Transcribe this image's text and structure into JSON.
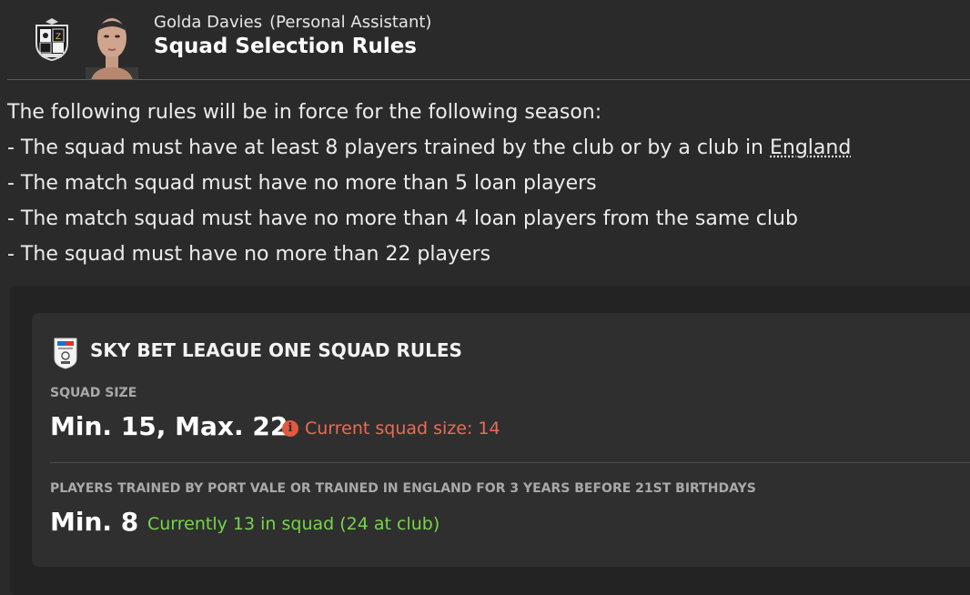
{
  "header": {
    "sender_name": "Golda Davies",
    "sender_role": "(Personal Assistant)",
    "subject": "Squad Selection Rules",
    "club_badge_icon": "port-vale-crest-icon",
    "avatar_icon": "assistant-portrait"
  },
  "message": {
    "intro": "The following rules will be in force for the following season:",
    "rules": [
      {
        "prefix": "- The squad must have at least 8 players trained by the club or by a club in ",
        "link": "England"
      },
      {
        "text": "- The match squad must have no more than 5 loan players"
      },
      {
        "text": "- The match squad must have no more than 4 loan players from the same club"
      },
      {
        "text": "- The squad must have no more than 22 players"
      }
    ]
  },
  "rules_card": {
    "league_badge_icon": "sky-bet-league-one-badge-icon",
    "title": "SKY BET LEAGUE ONE SQUAD RULES",
    "squad_size": {
      "label": "SQUAD SIZE",
      "value": "Min. 15, Max. 22",
      "status": "Current squad size: 14",
      "status_color": "#ef6a55"
    },
    "trained_players": {
      "label": "PLAYERS TRAINED BY PORT VALE OR TRAINED IN ENGLAND FOR 3 YEARS BEFORE 21ST BIRTHDAYS",
      "value": "Min. 8",
      "status": "Currently 13 in squad (24 at club)",
      "status_color": "#77d64a"
    }
  },
  "colors": {
    "background": "#2a2a2a",
    "card": "#2f2f2f",
    "panel": "#232323"
  }
}
